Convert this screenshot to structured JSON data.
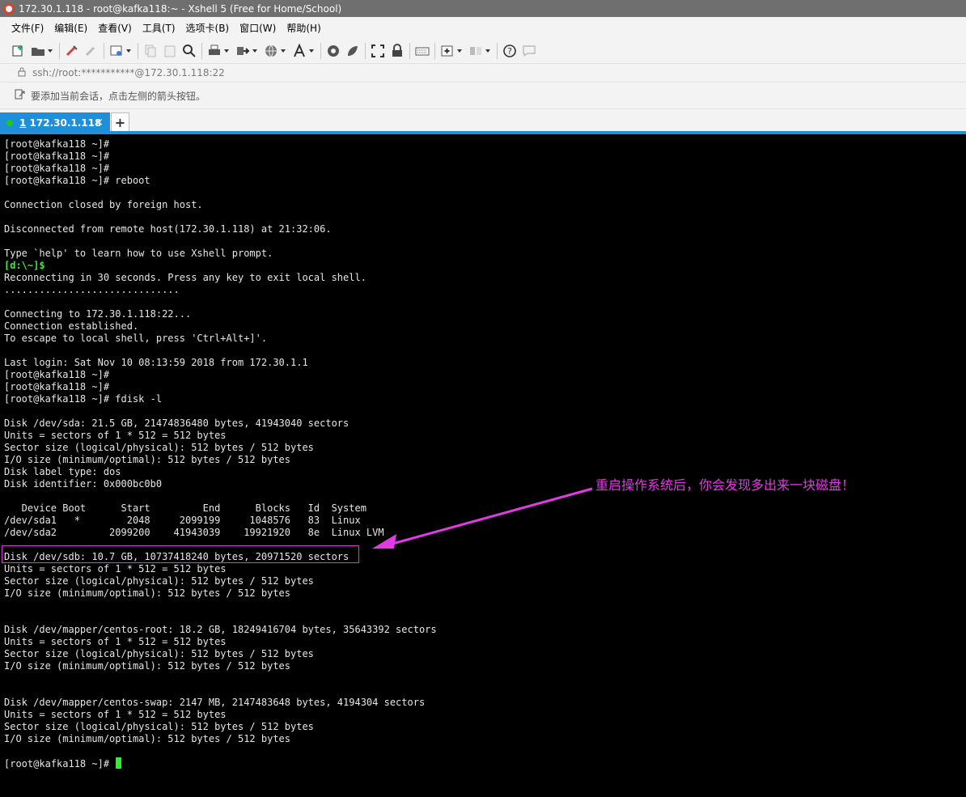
{
  "window": {
    "title": "172.30.1.118 - root@kafka118:~ - Xshell 5 (Free for Home/School)"
  },
  "menu": {
    "items": [
      "文件(F)",
      "编辑(E)",
      "查看(V)",
      "工具(T)",
      "选项卡(B)",
      "窗口(W)",
      "帮助(H)"
    ]
  },
  "toolbar": {
    "icons": [
      "new-session-icon",
      "open-folder-icon",
      "reconnect-icon",
      "disconnect-icon",
      "properties-icon",
      "copy-icon",
      "paste-icon",
      "find-icon",
      "print-icon",
      "transfer-icon",
      "globe-icon",
      "font-icon",
      "xftp-icon",
      "xftp-alt-icon",
      "fullscreen-icon",
      "lock-icon",
      "keyboard-icon",
      "add-tab-icon",
      "layout-icon",
      "help-icon",
      "chat-icon"
    ]
  },
  "address": {
    "text": "ssh://root:***********@172.30.1.118:22"
  },
  "hint": {
    "text": "要添加当前会话，点击左侧的箭头按钮。"
  },
  "tab": {
    "index": "1",
    "label": " 172.30.1.118",
    "close": "×",
    "new_tab": "+"
  },
  "terminal": {
    "lines": [
      "[root@kafka118 ~]#",
      "[root@kafka118 ~]#",
      "[root@kafka118 ~]#",
      "[root@kafka118 ~]# reboot",
      "",
      "Connection closed by foreign host.",
      "",
      "Disconnected from remote host(172.30.1.118) at 21:32:06.",
      "",
      "Type `help' to learn how to use Xshell prompt.",
      "[d:\\~]$",
      "Reconnecting in 30 seconds. Press any key to exit local shell.",
      "..............................",
      "",
      "Connecting to 172.30.1.118:22...",
      "Connection established.",
      "To escape to local shell, press 'Ctrl+Alt+]'.",
      "",
      "Last login: Sat Nov 10 08:13:59 2018 from 172.30.1.1",
      "[root@kafka118 ~]#",
      "[root@kafka118 ~]#",
      "[root@kafka118 ~]# fdisk -l",
      "",
      "Disk /dev/sda: 21.5 GB, 21474836480 bytes, 41943040 sectors",
      "Units = sectors of 1 * 512 = 512 bytes",
      "Sector size (logical/physical): 512 bytes / 512 bytes",
      "I/O size (minimum/optimal): 512 bytes / 512 bytes",
      "Disk label type: dos",
      "Disk identifier: 0x000bc0b0",
      "",
      "   Device Boot      Start         End      Blocks   Id  System",
      "/dev/sda1   *        2048     2099199     1048576   83  Linux",
      "/dev/sda2         2099200    41943039    19921920   8e  Linux LVM",
      "",
      "Disk /dev/sdb: 10.7 GB, 10737418240 bytes, 20971520 sectors",
      "Units = sectors of 1 * 512 = 512 bytes",
      "Sector size (logical/physical): 512 bytes / 512 bytes",
      "I/O size (minimum/optimal): 512 bytes / 512 bytes",
      "",
      "",
      "Disk /dev/mapper/centos-root: 18.2 GB, 18249416704 bytes, 35643392 sectors",
      "Units = sectors of 1 * 512 = 512 bytes",
      "Sector size (logical/physical): 512 bytes / 512 bytes",
      "I/O size (minimum/optimal): 512 bytes / 512 bytes",
      "",
      "",
      "Disk /dev/mapper/centos-swap: 2147 MB, 2147483648 bytes, 4194304 sectors",
      "Units = sectors of 1 * 512 = 512 bytes",
      "Sector size (logical/physical): 512 bytes / 512 bytes",
      "I/O size (minimum/optimal): 512 bytes / 512 bytes",
      "",
      "[root@kafka118 ~]#"
    ],
    "prompt_green_line": 10
  },
  "annotation": {
    "text": "重启操作系统后，你会发现多出来一块磁盘！",
    "color": "#e23ae2"
  },
  "colors": {
    "tab_active": "#1e8fd8",
    "terminal_bg": "#000000",
    "terminal_fg": "#e6e6e6",
    "cursor": "#2ef02e"
  }
}
